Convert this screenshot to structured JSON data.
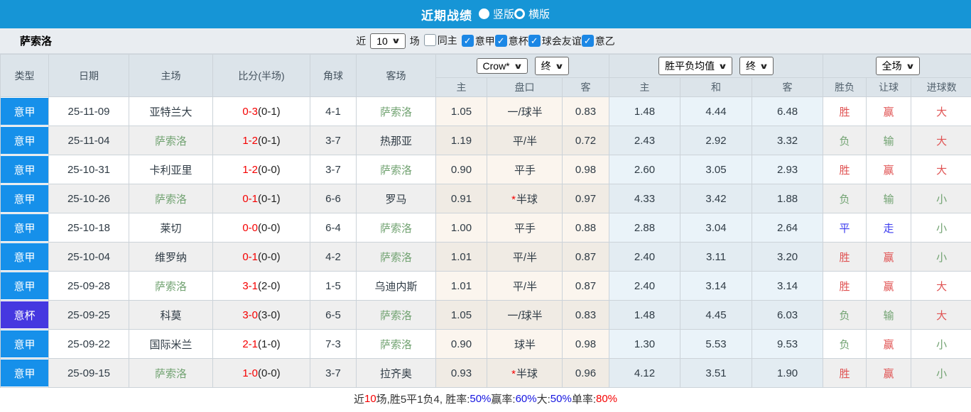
{
  "topbar": {
    "title": "近期战绩",
    "radios": [
      {
        "label": "竖版",
        "selected": true
      },
      {
        "label": "横版",
        "selected": false
      }
    ]
  },
  "filter": {
    "team": "萨索洛",
    "near_label": "近",
    "count_value": "10",
    "games_label": "场",
    "same_home": {
      "label": "同主",
      "checked": false
    },
    "leagues": [
      {
        "label": "意甲",
        "checked": true
      },
      {
        "label": "意杯",
        "checked": true
      },
      {
        "label": "球会友谊",
        "checked": true
      },
      {
        "label": "意乙",
        "checked": true
      }
    ]
  },
  "table": {
    "static_headers": [
      "类型",
      "日期",
      "主场",
      "比分(半场)",
      "角球",
      "客场"
    ],
    "groups": [
      {
        "selects": [
          "Crow*",
          "终"
        ],
        "cols": [
          "主",
          "盘口",
          "客"
        ]
      },
      {
        "selects": [
          "胜平负均值",
          "终"
        ],
        "cols": [
          "主",
          "和",
          "客"
        ]
      },
      {
        "selects": [
          "全场"
        ],
        "cols": [
          "胜负",
          "让球",
          "进球数"
        ]
      }
    ],
    "rows": [
      {
        "type": "意甲",
        "type_color": "blue",
        "date": "25-11-09",
        "home": "亚特兰大",
        "home_green": false,
        "score": "0-3",
        "half": "(0-1)",
        "corner": "4-1",
        "away": "萨索洛",
        "away_green": true,
        "ah_home": "1.05",
        "ah_star": false,
        "ah_line": "一/球半",
        "ah_away": "0.83",
        "avg_win": "1.48",
        "avg_draw": "4.44",
        "avg_lose": "6.48",
        "outcome": {
          "t": "胜",
          "c": "red"
        },
        "handicap": {
          "t": "赢",
          "c": "red"
        },
        "goals": {
          "t": "大",
          "c": "red"
        }
      },
      {
        "type": "意甲",
        "type_color": "blue",
        "date": "25-11-04",
        "home": "萨索洛",
        "home_green": true,
        "score": "1-2",
        "half": "(0-1)",
        "corner": "3-7",
        "away": "热那亚",
        "away_green": false,
        "ah_home": "1.19",
        "ah_star": false,
        "ah_line": "平/半",
        "ah_away": "0.72",
        "avg_win": "2.43",
        "avg_draw": "2.92",
        "avg_lose": "3.32",
        "outcome": {
          "t": "负",
          "c": "green"
        },
        "handicap": {
          "t": "输",
          "c": "green"
        },
        "goals": {
          "t": "大",
          "c": "red"
        }
      },
      {
        "type": "意甲",
        "type_color": "blue",
        "date": "25-10-31",
        "home": "卡利亚里",
        "home_green": false,
        "score": "1-2",
        "half": "(0-0)",
        "corner": "3-7",
        "away": "萨索洛",
        "away_green": true,
        "ah_home": "0.90",
        "ah_star": false,
        "ah_line": "平手",
        "ah_away": "0.98",
        "avg_win": "2.60",
        "avg_draw": "3.05",
        "avg_lose": "2.93",
        "outcome": {
          "t": "胜",
          "c": "red"
        },
        "handicap": {
          "t": "赢",
          "c": "red"
        },
        "goals": {
          "t": "大",
          "c": "red"
        }
      },
      {
        "type": "意甲",
        "type_color": "blue",
        "date": "25-10-26",
        "home": "萨索洛",
        "home_green": true,
        "score": "0-1",
        "half": "(0-1)",
        "corner": "6-6",
        "away": "罗马",
        "away_green": false,
        "ah_home": "0.91",
        "ah_star": true,
        "ah_line": "半球",
        "ah_away": "0.97",
        "avg_win": "4.33",
        "avg_draw": "3.42",
        "avg_lose": "1.88",
        "outcome": {
          "t": "负",
          "c": "green"
        },
        "handicap": {
          "t": "输",
          "c": "green"
        },
        "goals": {
          "t": "小",
          "c": "green"
        }
      },
      {
        "type": "意甲",
        "type_color": "blue",
        "date": "25-10-18",
        "home": "莱切",
        "home_green": false,
        "score": "0-0",
        "half": "(0-0)",
        "corner": "6-4",
        "away": "萨索洛",
        "away_green": true,
        "ah_home": "1.00",
        "ah_star": false,
        "ah_line": "平手",
        "ah_away": "0.88",
        "avg_win": "2.88",
        "avg_draw": "3.04",
        "avg_lose": "2.64",
        "outcome": {
          "t": "平",
          "c": "blue"
        },
        "handicap": {
          "t": "走",
          "c": "blue"
        },
        "goals": {
          "t": "小",
          "c": "green"
        }
      },
      {
        "type": "意甲",
        "type_color": "blue",
        "date": "25-10-04",
        "home": "维罗纳",
        "home_green": false,
        "score": "0-1",
        "half": "(0-0)",
        "corner": "4-2",
        "away": "萨索洛",
        "away_green": true,
        "ah_home": "1.01",
        "ah_star": false,
        "ah_line": "平/半",
        "ah_away": "0.87",
        "avg_win": "2.40",
        "avg_draw": "3.11",
        "avg_lose": "3.20",
        "outcome": {
          "t": "胜",
          "c": "red"
        },
        "handicap": {
          "t": "赢",
          "c": "red"
        },
        "goals": {
          "t": "小",
          "c": "green"
        }
      },
      {
        "type": "意甲",
        "type_color": "blue",
        "date": "25-09-28",
        "home": "萨索洛",
        "home_green": true,
        "score": "3-1",
        "half": "(2-0)",
        "corner": "1-5",
        "away": "乌迪内斯",
        "away_green": false,
        "ah_home": "1.01",
        "ah_star": false,
        "ah_line": "平/半",
        "ah_away": "0.87",
        "avg_win": "2.40",
        "avg_draw": "3.14",
        "avg_lose": "3.14",
        "outcome": {
          "t": "胜",
          "c": "red"
        },
        "handicap": {
          "t": "赢",
          "c": "red"
        },
        "goals": {
          "t": "大",
          "c": "red"
        }
      },
      {
        "type": "意杯",
        "type_color": "purple",
        "date": "25-09-25",
        "home": "科莫",
        "home_green": false,
        "score": "3-0",
        "half": "(3-0)",
        "corner": "6-5",
        "away": "萨索洛",
        "away_green": true,
        "ah_home": "1.05",
        "ah_star": false,
        "ah_line": "一/球半",
        "ah_away": "0.83",
        "avg_win": "1.48",
        "avg_draw": "4.45",
        "avg_lose": "6.03",
        "outcome": {
          "t": "负",
          "c": "green"
        },
        "handicap": {
          "t": "输",
          "c": "green"
        },
        "goals": {
          "t": "大",
          "c": "red"
        }
      },
      {
        "type": "意甲",
        "type_color": "blue",
        "date": "25-09-22",
        "home": "国际米兰",
        "home_green": false,
        "score": "2-1",
        "half": "(1-0)",
        "corner": "7-3",
        "away": "萨索洛",
        "away_green": true,
        "ah_home": "0.90",
        "ah_star": false,
        "ah_line": "球半",
        "ah_away": "0.98",
        "avg_win": "1.30",
        "avg_draw": "5.53",
        "avg_lose": "9.53",
        "outcome": {
          "t": "负",
          "c": "green"
        },
        "handicap": {
          "t": "赢",
          "c": "red"
        },
        "goals": {
          "t": "小",
          "c": "green"
        }
      },
      {
        "type": "意甲",
        "type_color": "blue",
        "date": "25-09-15",
        "home": "萨索洛",
        "home_green": true,
        "score": "1-0",
        "half": "(0-0)",
        "corner": "3-7",
        "away": "拉齐奥",
        "away_green": false,
        "ah_home": "0.93",
        "ah_star": true,
        "ah_line": "半球",
        "ah_away": "0.96",
        "avg_win": "4.12",
        "avg_draw": "3.51",
        "avg_lose": "1.90",
        "outcome": {
          "t": "胜",
          "c": "red"
        },
        "handicap": {
          "t": "赢",
          "c": "red"
        },
        "goals": {
          "t": "小",
          "c": "green"
        }
      }
    ]
  },
  "footer": {
    "segments": [
      {
        "t": "近",
        "c": "dark"
      },
      {
        "t": "10",
        "c": "red"
      },
      {
        "t": "场,胜5平1负4, 胜率:",
        "c": "dark"
      },
      {
        "t": "50%",
        "c": "blue"
      },
      {
        "t": " 赢率:",
        "c": "dark"
      },
      {
        "t": "60%",
        "c": "blue"
      },
      {
        "t": " 大:",
        "c": "dark"
      },
      {
        "t": "50%",
        "c": "blue"
      },
      {
        "t": " 单率:",
        "c": "dark"
      },
      {
        "t": "80%",
        "c": "red"
      }
    ]
  },
  "colors": {
    "topbar_blue": "#1695d6",
    "league_serie_a": "#1690ea",
    "league_cup": "#4538e0",
    "team_green": "#72a372",
    "score_red": "#f50000",
    "result_red": "#e05353",
    "result_green": "#72a372",
    "result_blue": "#3b3bef",
    "footer_blue": "#1414e0",
    "cream_col": "#fbf5ee",
    "blue_col": "#eaf3f9",
    "header_bg": "#dce4ea"
  }
}
